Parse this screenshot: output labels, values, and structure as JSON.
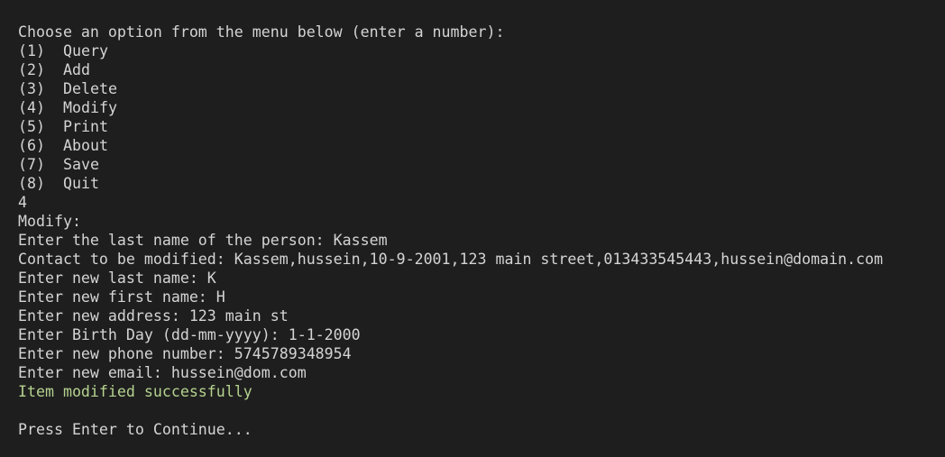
{
  "terminal": {
    "prompt": "Choose an option from the menu below (enter a number):",
    "menu": [
      {
        "number": "(1)",
        "label": "Query"
      },
      {
        "number": "(2)",
        "label": "Add"
      },
      {
        "number": "(3)",
        "label": "Delete"
      },
      {
        "number": "(4)",
        "label": "Modify"
      },
      {
        "number": "(5)",
        "label": "Print"
      },
      {
        "number": "(6)",
        "label": "About"
      },
      {
        "number": "(7)",
        "label": "Save"
      },
      {
        "number": "(8)",
        "label": "Quit"
      }
    ],
    "user_choice": "4",
    "section_title": "Modify:",
    "last_name_prompt": "Enter the last name of the person: Kassem",
    "contact_line": "Contact to be modified: Kassem,hussein,10-9-2001,123 main street,013433545443,hussein@domain.com",
    "new_last_name": "Enter new last name: K",
    "new_first_name": "Enter new first name: H",
    "new_address": "Enter new address: 123 main st",
    "birth_day": "Enter Birth Day (dd-mm-yyyy): 1-1-2000",
    "new_phone": "Enter new phone number: 5745789348954",
    "new_email": "Enter new email: hussein@dom.com",
    "success_message": "Item modified successfully",
    "continue_prompt": "Press Enter to Continue..."
  },
  "colors": {
    "background": "#1e1e1e",
    "text": "#d4d4d4",
    "success": "#b5d38f"
  }
}
